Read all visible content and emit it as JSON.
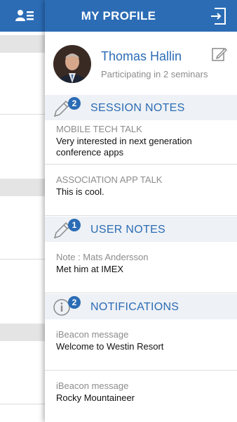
{
  "header": {
    "title": "MY PROFILE",
    "logout_icon": "logout-icon",
    "menu_icon": "contacts-menu-icon"
  },
  "profile": {
    "name": "Thomas Hallin",
    "subtitle": "Participating in 2 seminars",
    "edit_icon": "edit-icon"
  },
  "sections": {
    "session_notes": {
      "title": "SESSION NOTES",
      "badge": "2",
      "icon": "pencil-icon",
      "items": [
        {
          "label": "MOBILE TECH TALK",
          "text": "Very interested in next generation conference apps"
        },
        {
          "label": "ASSOCIATION APP TALK",
          "text": "This is cool."
        }
      ]
    },
    "user_notes": {
      "title": "USER NOTES",
      "badge": "1",
      "icon": "pencil-icon",
      "items": [
        {
          "label": "Note : Mats Andersson",
          "text": "Met him at IMEX"
        }
      ]
    },
    "notifications": {
      "title": "NOTIFICATIONS",
      "badge": "2",
      "icon": "info-icon",
      "items": [
        {
          "label": "iBeacon message",
          "text": "Welcome to Westin Resort"
        },
        {
          "label": "iBeacon message",
          "text": "Rocky Mountaineer"
        }
      ]
    }
  },
  "colors": {
    "accent": "#2b6cb5",
    "section_bg": "#eef1f5",
    "muted_text": "#8c8c8c"
  }
}
